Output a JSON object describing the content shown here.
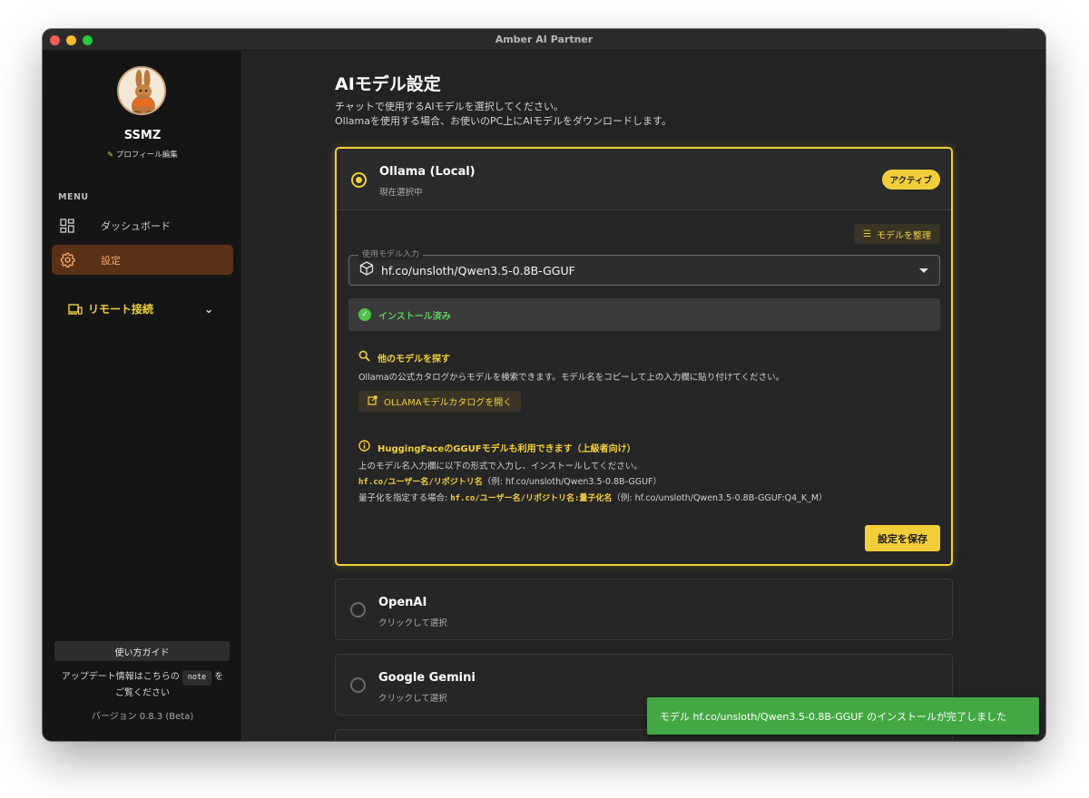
{
  "window": {
    "title": "Amber AI Partner"
  },
  "profile": {
    "name": "SSMZ",
    "edit_label": "プロフィール編集"
  },
  "sidebar": {
    "menu_label": "MENU",
    "items": [
      {
        "label": "ダッシュボード",
        "icon": "dashboard-icon"
      },
      {
        "label": "設定",
        "icon": "gear-icon",
        "active": true
      }
    ],
    "remote": {
      "label": "リモート接続",
      "icon": "devices-icon"
    },
    "guide_label": "使い方ガイド",
    "update_prefix": "アップデート情報はこちらの",
    "update_note": "note",
    "update_suffix": "を",
    "update_line2": "ご覧ください",
    "version": "バージョン 0.8.3 (Beta)"
  },
  "page": {
    "title": "AIモデル設定",
    "desc_line1": "チャットで使用するAIモデルを選択してください。",
    "desc_line2": "Ollamaを使用する場合、お使いのPC上にAIモデルをダウンロードします。"
  },
  "providers": {
    "ollama": {
      "title": "Ollama (Local)",
      "subtitle": "現在選択中",
      "badge": "アクティブ",
      "organize_label": "モデルを整理",
      "select_label": "使用モデル入力",
      "select_value": "hf.co/unsloth/Qwen3.5-0.8B-GGUF",
      "installed_label": "インストール済み",
      "find_title": "他のモデルを探す",
      "find_desc": "Ollamaの公式カタログからモデルを検索できます。モデル名をコピーして上の入力欄に貼り付けてください。",
      "catalog_button": "OLLAMAモデルカタログを開く",
      "hf_title": "HuggingFaceのGGUFモデルも利用できます（上級者向け）",
      "hf_line1": "上のモデル名入力欄に以下の形式で入力し、インストールしてください。",
      "hf_code1": "hf.co/ユーザー名/リポジトリ名",
      "hf_example1": "（例: hf.co/unsloth/Qwen3.5-0.8B-GGUF）",
      "hf_line3_prefix": "量子化を指定する場合: ",
      "hf_code2": "hf.co/ユーザー名/リポジトリ名:量子化名",
      "hf_example2": "（例: hf.co/unsloth/Qwen3.5-0.8B-GGUF:Q4_K_M）",
      "save_button": "設定を保存"
    },
    "openai": {
      "title": "OpenAI",
      "subtitle": "クリックして選択"
    },
    "gemini": {
      "title": "Google Gemini",
      "subtitle": "クリックして選択"
    }
  },
  "toast": {
    "message": "モデル hf.co/unsloth/Qwen3.5-0.8B-GGUF のインストールが完了しました"
  },
  "colors": {
    "accent": "#f2cf3a",
    "active_nav_bg": "#5a3017",
    "active_nav_text": "#f2a76d",
    "success": "#43a843"
  }
}
